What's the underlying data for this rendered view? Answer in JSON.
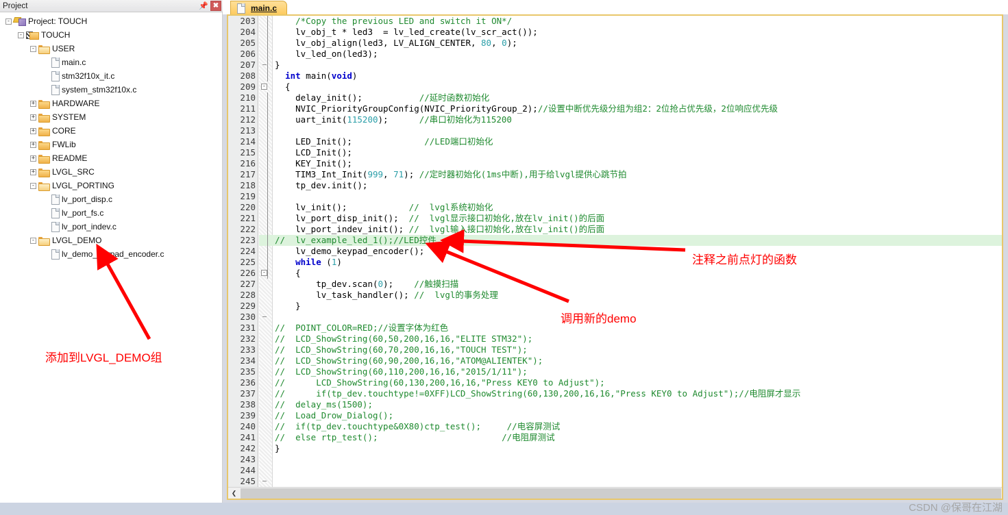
{
  "project_panel": {
    "title": "Project",
    "pin_icon": "pin-icon",
    "close_icon": "close-icon",
    "tree": [
      {
        "label": "Project: TOUCH",
        "depth": 0,
        "icon": "project-icon",
        "expander": "-"
      },
      {
        "label": "TOUCH",
        "depth": 1,
        "icon": "target-icon",
        "expander": "-"
      },
      {
        "label": "USER",
        "depth": 2,
        "icon": "folder-open-icon",
        "expander": "-"
      },
      {
        "label": "main.c",
        "depth": 3,
        "icon": "file-icon",
        "expander": ""
      },
      {
        "label": "stm32f10x_it.c",
        "depth": 3,
        "icon": "file-icon",
        "expander": ""
      },
      {
        "label": "system_stm32f10x.c",
        "depth": 3,
        "icon": "file-icon",
        "expander": ""
      },
      {
        "label": "HARDWARE",
        "depth": 2,
        "icon": "folder-icon",
        "expander": "+"
      },
      {
        "label": "SYSTEM",
        "depth": 2,
        "icon": "folder-icon",
        "expander": "+"
      },
      {
        "label": "CORE",
        "depth": 2,
        "icon": "folder-icon",
        "expander": "+"
      },
      {
        "label": "FWLib",
        "depth": 2,
        "icon": "folder-icon",
        "expander": "+"
      },
      {
        "label": "README",
        "depth": 2,
        "icon": "folder-icon",
        "expander": "+"
      },
      {
        "label": "LVGL_SRC",
        "depth": 2,
        "icon": "folder-icon",
        "expander": "+"
      },
      {
        "label": "LVGL_PORTING",
        "depth": 2,
        "icon": "folder-open-icon",
        "expander": "-"
      },
      {
        "label": "lv_port_disp.c",
        "depth": 3,
        "icon": "file-icon",
        "expander": ""
      },
      {
        "label": "lv_port_fs.c",
        "depth": 3,
        "icon": "file-icon",
        "expander": ""
      },
      {
        "label": "lv_port_indev.c",
        "depth": 3,
        "icon": "file-icon",
        "expander": ""
      },
      {
        "label": "LVGL_DEMO",
        "depth": 2,
        "icon": "folder-open-icon",
        "expander": "-"
      },
      {
        "label": "lv_demo_keypad_encoder.c",
        "depth": 3,
        "icon": "file-icon",
        "expander": ""
      }
    ]
  },
  "editor": {
    "tab": {
      "label": "main.c",
      "icon": "file-icon"
    },
    "first_line_number": 203,
    "highlighted_line": 223,
    "scroll_left_icon": "chevron-left-icon",
    "lines": [
      {
        "n": 203,
        "tokens": [
          {
            "t": "    ",
            "c": ""
          },
          {
            "t": "/*Copy the previous LED and switch it ON*/",
            "c": "cmt"
          }
        ]
      },
      {
        "n": 204,
        "tokens": [
          {
            "t": "    lv_obj_t * led3  = lv_led_create(lv_scr_act());",
            "c": ""
          }
        ]
      },
      {
        "n": 205,
        "tokens": [
          {
            "t": "    lv_obj_align(led3, LV_ALIGN_CENTER, ",
            "c": ""
          },
          {
            "t": "80",
            "c": "num"
          },
          {
            "t": ", ",
            "c": ""
          },
          {
            "t": "0",
            "c": "num"
          },
          {
            "t": ");",
            "c": ""
          }
        ]
      },
      {
        "n": 206,
        "tokens": [
          {
            "t": "    lv_led_on(led3);",
            "c": ""
          }
        ]
      },
      {
        "n": 207,
        "tokens": [
          {
            "t": "}",
            "c": ""
          }
        ],
        "fold_end": true
      },
      {
        "n": 208,
        "tokens": [
          {
            "t": "  ",
            "c": ""
          },
          {
            "t": "int",
            "c": "kw"
          },
          {
            "t": " main(",
            "c": ""
          },
          {
            "t": "void",
            "c": "kw"
          },
          {
            "t": ")",
            "c": ""
          }
        ]
      },
      {
        "n": 209,
        "tokens": [
          {
            "t": "  {",
            "c": ""
          }
        ],
        "fold": "-"
      },
      {
        "n": 210,
        "tokens": [
          {
            "t": "    delay_init();           ",
            "c": ""
          },
          {
            "t": "//延时函数初始化",
            "c": "cmt"
          }
        ]
      },
      {
        "n": 211,
        "tokens": [
          {
            "t": "    NVIC_PriorityGroupConfig(NVIC_PriorityGroup_2);",
            "c": ""
          },
          {
            "t": "//设置中断优先级分组为组2：2位抢占优先级，2位响应优先级",
            "c": "cmt"
          }
        ]
      },
      {
        "n": 212,
        "tokens": [
          {
            "t": "    uart_init(",
            "c": ""
          },
          {
            "t": "115200",
            "c": "num"
          },
          {
            "t": ");      ",
            "c": ""
          },
          {
            "t": "//串口初始化为115200",
            "c": "cmt"
          }
        ]
      },
      {
        "n": 213,
        "tokens": [
          {
            "t": "",
            "c": ""
          }
        ]
      },
      {
        "n": 214,
        "tokens": [
          {
            "t": "    LED_Init();              ",
            "c": ""
          },
          {
            "t": "//LED端口初始化",
            "c": "cmt"
          }
        ]
      },
      {
        "n": 215,
        "tokens": [
          {
            "t": "    LCD_Init();",
            "c": ""
          }
        ]
      },
      {
        "n": 216,
        "tokens": [
          {
            "t": "    KEY_Init();",
            "c": ""
          }
        ]
      },
      {
        "n": 217,
        "tokens": [
          {
            "t": "    TIM3_Int_Init(",
            "c": ""
          },
          {
            "t": "999",
            "c": "num"
          },
          {
            "t": ", ",
            "c": ""
          },
          {
            "t": "71",
            "c": "num"
          },
          {
            "t": "); ",
            "c": ""
          },
          {
            "t": "//定时器初始化(1ms中断),用于给lvgl提供心跳节拍",
            "c": "cmt"
          }
        ]
      },
      {
        "n": 218,
        "tokens": [
          {
            "t": "    tp_dev.init();",
            "c": ""
          }
        ]
      },
      {
        "n": 219,
        "tokens": [
          {
            "t": "",
            "c": ""
          }
        ]
      },
      {
        "n": 220,
        "tokens": [
          {
            "t": "    lv_init();            ",
            "c": ""
          },
          {
            "t": "//  lvgl系统初始化",
            "c": "cmt"
          }
        ]
      },
      {
        "n": 221,
        "tokens": [
          {
            "t": "    lv_port_disp_init();  ",
            "c": ""
          },
          {
            "t": "//  lvgl显示接口初始化,放在lv_init()的后面",
            "c": "cmt"
          }
        ]
      },
      {
        "n": 222,
        "tokens": [
          {
            "t": "    lv_port_indev_init(); ",
            "c": ""
          },
          {
            "t": "//  lvgl输入接口初始化,放在lv_init()的后面",
            "c": "cmt"
          }
        ]
      },
      {
        "n": 223,
        "tokens": [
          {
            "t": "//  lv_example_led_1();//LED控件",
            "c": "cmt"
          }
        ],
        "highlight": true
      },
      {
        "n": 224,
        "tokens": [
          {
            "t": "    lv_demo_keypad_encoder();",
            "c": ""
          }
        ]
      },
      {
        "n": 225,
        "tokens": [
          {
            "t": "    ",
            "c": ""
          },
          {
            "t": "while",
            "c": "kw"
          },
          {
            "t": " (",
            "c": ""
          },
          {
            "t": "1",
            "c": "num"
          },
          {
            "t": ")",
            "c": ""
          }
        ]
      },
      {
        "n": 226,
        "tokens": [
          {
            "t": "    {",
            "c": ""
          }
        ],
        "fold": "-"
      },
      {
        "n": 227,
        "tokens": [
          {
            "t": "        tp_dev.scan(",
            "c": ""
          },
          {
            "t": "0",
            "c": "num"
          },
          {
            "t": ");    ",
            "c": ""
          },
          {
            "t": "//触摸扫描",
            "c": "cmt"
          }
        ]
      },
      {
        "n": 228,
        "tokens": [
          {
            "t": "        lv_task_handler(); ",
            "c": ""
          },
          {
            "t": "//  lvgl的事务处理",
            "c": "cmt"
          }
        ]
      },
      {
        "n": 229,
        "tokens": [
          {
            "t": "    }",
            "c": ""
          }
        ]
      },
      {
        "n": 230,
        "tokens": [
          {
            "t": "",
            "c": ""
          }
        ],
        "fold_end": true
      },
      {
        "n": 231,
        "tokens": [
          {
            "t": "//  POINT_COLOR=RED;//设置字体为红色",
            "c": "cmt"
          }
        ]
      },
      {
        "n": 232,
        "tokens": [
          {
            "t": "//  LCD_ShowString(60,50,200,16,16,\"ELITE STM32\");",
            "c": "cmt"
          }
        ]
      },
      {
        "n": 233,
        "tokens": [
          {
            "t": "//  LCD_ShowString(60,70,200,16,16,\"TOUCH TEST\");",
            "c": "cmt"
          }
        ]
      },
      {
        "n": 234,
        "tokens": [
          {
            "t": "//  LCD_ShowString(60,90,200,16,16,\"ATOM@ALIENTEK\");",
            "c": "cmt"
          }
        ]
      },
      {
        "n": 235,
        "tokens": [
          {
            "t": "//  LCD_ShowString(60,110,200,16,16,\"2015/1/11\");",
            "c": "cmt"
          }
        ]
      },
      {
        "n": 236,
        "tokens": [
          {
            "t": "//      LCD_ShowString(60,130,200,16,16,\"Press KEY0 to Adjust\");",
            "c": "cmt"
          }
        ]
      },
      {
        "n": 237,
        "tokens": [
          {
            "t": "//      if(tp_dev.touchtype!=0XFF)LCD_ShowString(60,130,200,16,16,\"Press KEY0 to Adjust\");//电阻屏才显示",
            "c": "cmt"
          }
        ]
      },
      {
        "n": 238,
        "tokens": [
          {
            "t": "//  delay_ms(1500);",
            "c": "cmt"
          }
        ]
      },
      {
        "n": 239,
        "tokens": [
          {
            "t": "//  Load_Drow_Dialog();",
            "c": "cmt"
          }
        ]
      },
      {
        "n": 240,
        "tokens": [
          {
            "t": "//  if(tp_dev.touchtype&0X80)ctp_test();     //电容屏测试",
            "c": "cmt"
          }
        ]
      },
      {
        "n": 241,
        "tokens": [
          {
            "t": "//  else rtp_test();                        //电阻屏测试",
            "c": "cmt"
          }
        ]
      },
      {
        "n": 242,
        "tokens": [
          {
            "t": "}",
            "c": ""
          }
        ]
      },
      {
        "n": 243,
        "tokens": [
          {
            "t": "",
            "c": ""
          }
        ]
      },
      {
        "n": 244,
        "tokens": [
          {
            "t": "",
            "c": ""
          }
        ]
      },
      {
        "n": 245,
        "tokens": [
          {
            "t": "",
            "c": ""
          }
        ],
        "fold_end": true
      }
    ]
  },
  "annotations": {
    "color": "#ff0000",
    "left_note": "添加到LVGL_DEMO组",
    "right_note_1": "注释之前点灯的函数",
    "right_note_2": "调用新的demo"
  },
  "statusbar": {
    "watermark": "CSDN @保哥在江湖"
  }
}
